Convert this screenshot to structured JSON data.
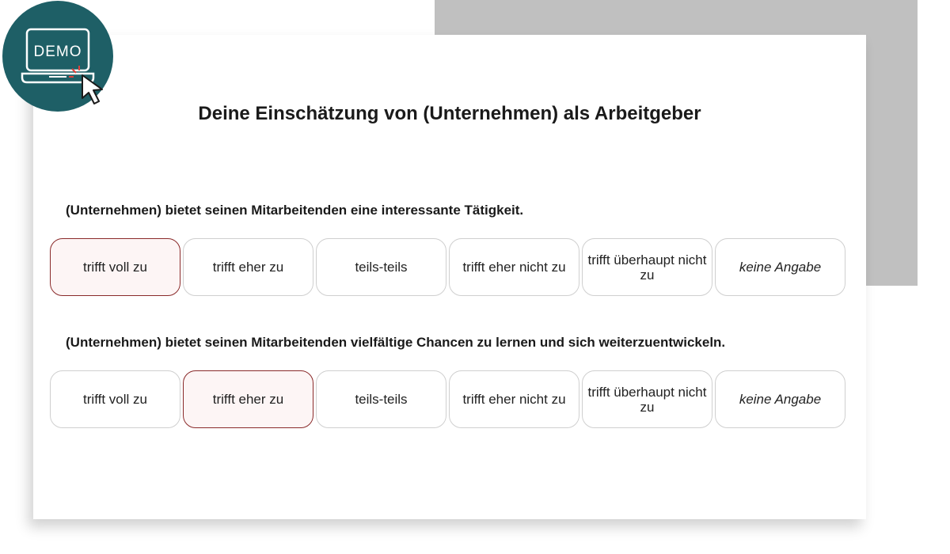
{
  "badge": {
    "label": "DEMO",
    "icon": "laptop-cursor-icon",
    "color": "#1e5f66"
  },
  "survey": {
    "title": "Deine Einschätzung von (Unternehmen) als Arbeitgeber",
    "questions": [
      {
        "text": "(Unternehmen) bietet seinen Mitarbeitenden eine interessante Tätigkeit.",
        "selected": "trifft voll zu",
        "options": [
          "trifft voll zu",
          "trifft eher zu",
          "teils-teils",
          "trifft eher nicht zu",
          "trifft überhaupt nicht zu",
          "keine Angabe"
        ]
      },
      {
        "text": "(Unternehmen) bietet seinen Mitarbeitenden vielfältige Chancen zu lernen und sich weiterzuentwickeln.",
        "selected": "trifft eher zu",
        "options": [
          "trifft voll zu",
          "trifft eher zu",
          "teils-teils",
          "trifft eher nicht zu",
          "trifft überhaupt nicht zu",
          "keine Angabe"
        ]
      }
    ]
  },
  "colors": {
    "selected_border": "#8a2a2a",
    "background_panel": "#c0c0c0"
  }
}
